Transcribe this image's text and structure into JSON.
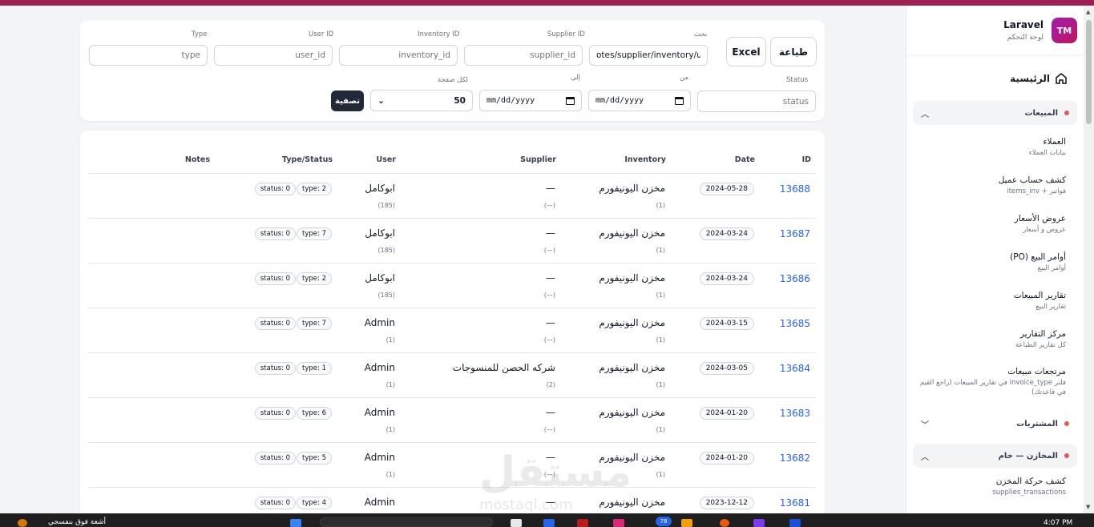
{
  "sidebar": {
    "brand_initials": "TM",
    "brand_name": "Laravel",
    "brand_sub": "لوحة التحكم",
    "home_label": "الرئيسية",
    "groups": [
      {
        "label": "المبيعات"
      },
      {
        "label": "المشتريات"
      },
      {
        "label": "المخازن — خام"
      }
    ],
    "sales_items": [
      {
        "title": "العملاء",
        "sub": "بيانات العملاء"
      },
      {
        "title": "كشف حساب عميل",
        "sub": "فواتير + items_inv"
      },
      {
        "title": "عروض الأسعار",
        "sub": "عروض و أسعار"
      },
      {
        "title": "أوامر البيع (PO)",
        "sub": "أوامر البيع"
      },
      {
        "title": "تقارير المبيعات",
        "sub": "تقارير البيع"
      },
      {
        "title": "مركز التقارير",
        "sub": "كل تقارير الطباعة"
      },
      {
        "title": "مرتجعات مبيعات",
        "sub": "فلتر invoice_type في تقارير المبيعات (راجع القيم في قاعدتك)"
      }
    ],
    "stores_items": [
      {
        "title": "كشف حركة المخزن",
        "sub": "supplies_transactions"
      }
    ]
  },
  "filters": {
    "print_label": "طباعة",
    "excel_label": "Excel",
    "search": {
      "label": "بحث",
      "value": "otes/supplier/inventory/user"
    },
    "supplier_id": {
      "label": "Supplier ID",
      "placeholder": "supplier_id"
    },
    "inventory_id": {
      "label": "Inventory ID",
      "placeholder": "inventory_id"
    },
    "user_id": {
      "label": "User ID",
      "placeholder": "user_id"
    },
    "type": {
      "label": "Type",
      "placeholder": "type"
    },
    "status": {
      "label": "Status",
      "placeholder": "status"
    },
    "from": {
      "label": "من",
      "value": "mm/dd/yyyy"
    },
    "to": {
      "label": "إلى",
      "value": "mm/dd/yyyy"
    },
    "per_page": {
      "label": "لكل صفحة",
      "value": "50"
    },
    "filter_button": "تصفية"
  },
  "table": {
    "headers": {
      "id": "ID",
      "date": "Date",
      "inventory": "Inventory",
      "supplier": "Supplier",
      "user": "User",
      "type_status": "Type/Status",
      "notes": "Notes"
    },
    "rows": [
      {
        "id": "13688",
        "date": "2024-05-28",
        "inventory": "مخزن اليونيفورم",
        "inventory_sub": "(1)",
        "supplier": "—",
        "supplier_sub": "(—)",
        "user": "ابوكامل",
        "user_sub": "(185)",
        "type": "type: 2",
        "status": "status: 0"
      },
      {
        "id": "13687",
        "date": "2024-03-24",
        "inventory": "مخزن اليونيفورم",
        "inventory_sub": "(1)",
        "supplier": "—",
        "supplier_sub": "(—)",
        "user": "ابوكامل",
        "user_sub": "(185)",
        "type": "type: 7",
        "status": "status: 0"
      },
      {
        "id": "13686",
        "date": "2024-03-24",
        "inventory": "مخزن اليونيفورم",
        "inventory_sub": "(1)",
        "supplier": "—",
        "supplier_sub": "(—)",
        "user": "ابوكامل",
        "user_sub": "(185)",
        "type": "type: 2",
        "status": "status: 0"
      },
      {
        "id": "13685",
        "date": "2024-03-15",
        "inventory": "مخزن اليونيفورم",
        "inventory_sub": "(1)",
        "supplier": "—",
        "supplier_sub": "(—)",
        "user": "Admin",
        "user_sub": "(1)",
        "type": "type: 7",
        "status": "status: 0"
      },
      {
        "id": "13684",
        "date": "2024-03-05",
        "inventory": "مخزن اليونيفورم",
        "inventory_sub": "(1)",
        "supplier": "شركه الحصن للمنسوجات",
        "supplier_sub": "(2)",
        "user": "Admin",
        "user_sub": "(1)",
        "type": "type: 1",
        "status": "status: 0"
      },
      {
        "id": "13683",
        "date": "2024-01-20",
        "inventory": "مخزن اليونيفورم",
        "inventory_sub": "(1)",
        "supplier": "—",
        "supplier_sub": "(—)",
        "user": "Admin",
        "user_sub": "(1)",
        "type": "type: 6",
        "status": "status: 0"
      },
      {
        "id": "13682",
        "date": "2024-01-20",
        "inventory": "مخزن اليونيفورم",
        "inventory_sub": "(1)",
        "supplier": "—",
        "supplier_sub": "(—)",
        "user": "Admin",
        "user_sub": "(1)",
        "type": "type: 5",
        "status": "status: 0"
      },
      {
        "id": "13681",
        "date": "2023-12-12",
        "inventory": "مخزن اليونيفورم",
        "inventory_sub": "",
        "supplier": "—",
        "supplier_sub": "",
        "user": "Admin",
        "user_sub": "",
        "type": "type: 4",
        "status": "status: 0"
      }
    ]
  },
  "watermark": {
    "text": "مستقل",
    "sub": "mostaql.com"
  },
  "taskbar": {
    "left_text": "أشعة فوق بنفسجي",
    "clock": "4:07 PM",
    "badge": "78"
  },
  "colors": {
    "topbar": "#9d1f54",
    "accent": "#2563eb",
    "dot": "#e15a5a"
  }
}
